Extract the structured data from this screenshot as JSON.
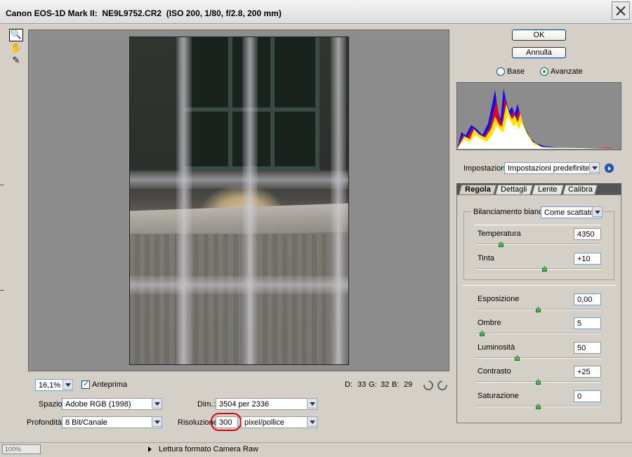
{
  "window": {
    "title": "Canon EOS-1D Mark II:  NE9L9752.CR2  (ISO 200, 1/80, f/2.8, 200 mm)"
  },
  "tools": [
    {
      "name": "zoom-tool-icon",
      "glyph": "🔍"
    },
    {
      "name": "hand-tool-icon",
      "glyph": "✋"
    },
    {
      "name": "eyedropper-tool-icon",
      "glyph": "✎"
    }
  ],
  "preview": {
    "zoom": "16,1%",
    "preview_label": "Anteprima",
    "readout": {
      "d_label": "D:",
      "r": "33",
      "g_label": "G:",
      "g": "32",
      "b_label": "B:",
      "b": "29"
    }
  },
  "workflow": {
    "space_label": "Spazio:",
    "space_value": "Adobe RGB (1998)",
    "depth_label": "Profondità:",
    "depth_value": "8 Bit/Canale",
    "size_label": "Dim.:",
    "size_value": "3504 per 2336",
    "resolution_label": "Risoluzione:",
    "resolution_value": "300",
    "resolution_unit": "pixel/pollice"
  },
  "actions": {
    "ok": "OK",
    "cancel": "Annulla"
  },
  "mode": {
    "basic": "Base",
    "advanced": "Avanzate"
  },
  "settings": {
    "label": "Impostazioni:",
    "value": "Impostazioni predefinite foto"
  },
  "tabs": [
    {
      "label": "Regola",
      "active": true
    },
    {
      "label": "Dettagli",
      "active": false
    },
    {
      "label": "Lente",
      "active": false
    },
    {
      "label": "Calibra",
      "active": false
    }
  ],
  "white_balance": {
    "label": "Bilanciamento bianco:",
    "value": "Come scattato"
  },
  "adjustments": [
    {
      "label": "Temperatura",
      "value": "4350",
      "level": 0.2
    },
    {
      "label": "Tinta",
      "value": "+10",
      "level": 0.55
    },
    {
      "label": "Esposizione",
      "value": "0,00",
      "level": 0.5
    },
    {
      "label": "Ombre",
      "value": "5",
      "level": 0.05
    },
    {
      "label": "Luminosità",
      "value": "50",
      "level": 0.33
    },
    {
      "label": "Contrasto",
      "value": "+25",
      "level": 0.5
    },
    {
      "label": "Saturazione",
      "value": "0",
      "level": 0.5
    }
  ],
  "status": {
    "zoom": "100%",
    "message": "Lettura formato Camera Raw"
  },
  "colors": {
    "accent_red": "#e00000",
    "ok_border": "#003c74"
  }
}
